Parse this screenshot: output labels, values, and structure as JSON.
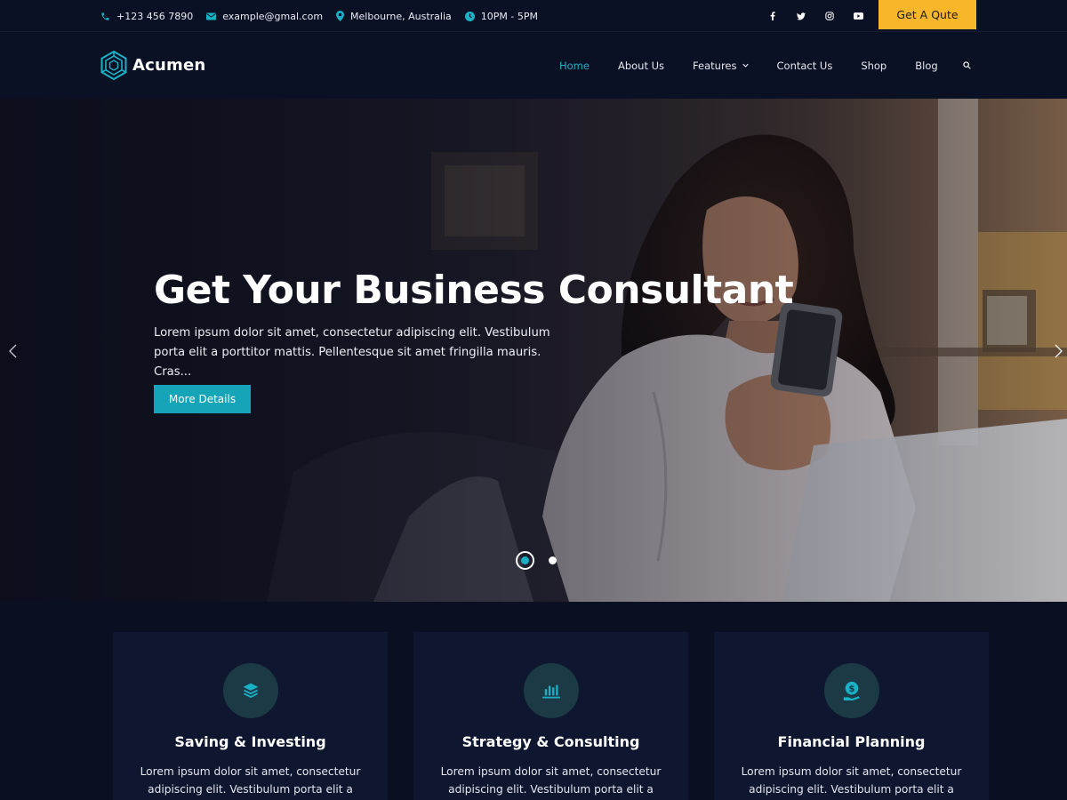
{
  "colors": {
    "accent": "#19b1c6",
    "quote_button": "#f8b62b",
    "background": "#0a0f22",
    "card": "#0f1730"
  },
  "topbar": {
    "phone": "+123 456 7890",
    "email": "example@gmal.com",
    "location": "Melbourne, Australia",
    "hours": "10PM - 5PM",
    "icons": [
      "phone-icon",
      "envelope-icon",
      "map-pin-icon",
      "clock-icon"
    ],
    "socials": [
      "facebook-icon",
      "twitter-icon",
      "instagram-icon",
      "youtube-icon"
    ],
    "quote_button": "Get A Qute"
  },
  "header": {
    "logo_text": "Acumen",
    "nav": {
      "home": "Home",
      "about": "About Us",
      "features": "Features",
      "contact": "Contact Us",
      "shop": "Shop",
      "blog": "Blog"
    },
    "active_item": "Home"
  },
  "hero": {
    "title": "Get Your Business Consultant",
    "text": "Lorem ipsum dolor sit amet, consectetur adipiscing elit. Vestibulum porta elit a porttitor mattis. Pellentesque sit amet fringilla mauris. Cras...",
    "button": "More Details",
    "slide_count": 2,
    "active_slide": 1
  },
  "features": {
    "cards": [
      {
        "icon": "layers-icon",
        "title": "Saving & Investing",
        "text": "Lorem ipsum dolor sit amet, consectetur adipiscing elit. Vestibulum porta elit a"
      },
      {
        "icon": "bar-chart-icon",
        "title": "Strategy & Consulting",
        "text": "Lorem ipsum dolor sit amet, consectetur adipiscing elit. Vestibulum porta elit a"
      },
      {
        "icon": "dollar-hand-icon",
        "title": "Financial Planning",
        "text": "Lorem ipsum dolor sit amet, consectetur adipiscing elit. Vestibulum porta elit a"
      }
    ]
  }
}
